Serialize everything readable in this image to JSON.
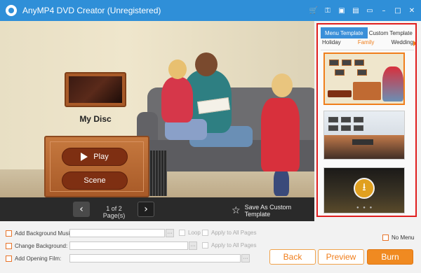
{
  "titlebar": {
    "title": "AnyMP4 DVD Creator (Unregistered)",
    "icons": [
      "cart-icon",
      "key-icon",
      "lock-icon",
      "document-icon",
      "feedback-icon",
      "minimize-icon",
      "maximize-icon",
      "close-icon"
    ]
  },
  "preview": {
    "disc_title": "My Disc",
    "play_label": "Play",
    "scene_label": "Scene"
  },
  "pager": {
    "page_info": "1 of 2 Page(s)",
    "save_template_label": "Save As Custom Template"
  },
  "template_panel": {
    "tabs": [
      "Menu Template",
      "Custom Template"
    ],
    "active_tab": "Menu Template",
    "categories": [
      "Holiday",
      "Family",
      "Wedding"
    ],
    "active_category": "Family",
    "accent_color": "#f07e1b",
    "highlight_color": "#e01e1e"
  },
  "options": {
    "bg_music_label": "Add Background Music:",
    "change_bg_label": "Change Background:",
    "opening_film_label": "Add Opening Film:",
    "loop_label": "Loop",
    "apply_all_label": "Apply to All Pages",
    "no_menu_label": "No Menu",
    "browse_label": "···"
  },
  "actions": {
    "back_label": "Back",
    "preview_label": "Preview",
    "burn_label": "Burn"
  }
}
